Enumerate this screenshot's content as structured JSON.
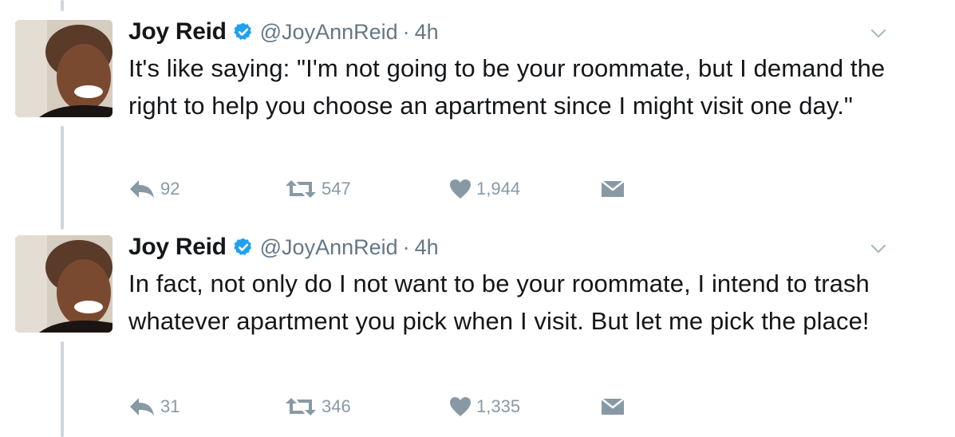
{
  "tweets": [
    {
      "name": "Joy Reid",
      "handle": "@JoyAnnReid",
      "separator": "·",
      "time": "4h",
      "text": "It's like saying: \"I'm not going to be your roommate, but I demand the right to help you choose an apartment since I might visit one day.\"",
      "replies": "92",
      "retweets": "547",
      "likes": "1,944"
    },
    {
      "name": "Joy Reid",
      "handle": "@JoyAnnReid",
      "separator": "·",
      "time": "4h",
      "text": "In fact, not only do I not want to be your roommate, I intend to trash whatever apartment you pick when I visit. But let me pick the place!",
      "replies": "31",
      "retweets": "346",
      "likes": "1,335"
    }
  ],
  "icons": {
    "verified": "verified-badge-icon",
    "caret": "chevron-down-icon",
    "reply": "reply-icon",
    "retweet": "retweet-icon",
    "like": "heart-icon",
    "message": "envelope-icon"
  },
  "colors": {
    "verified_blue": "#1da1f2",
    "muted_gray": "#8899a6",
    "handle_gray": "#657786",
    "thread_line": "#ccd6dd"
  }
}
